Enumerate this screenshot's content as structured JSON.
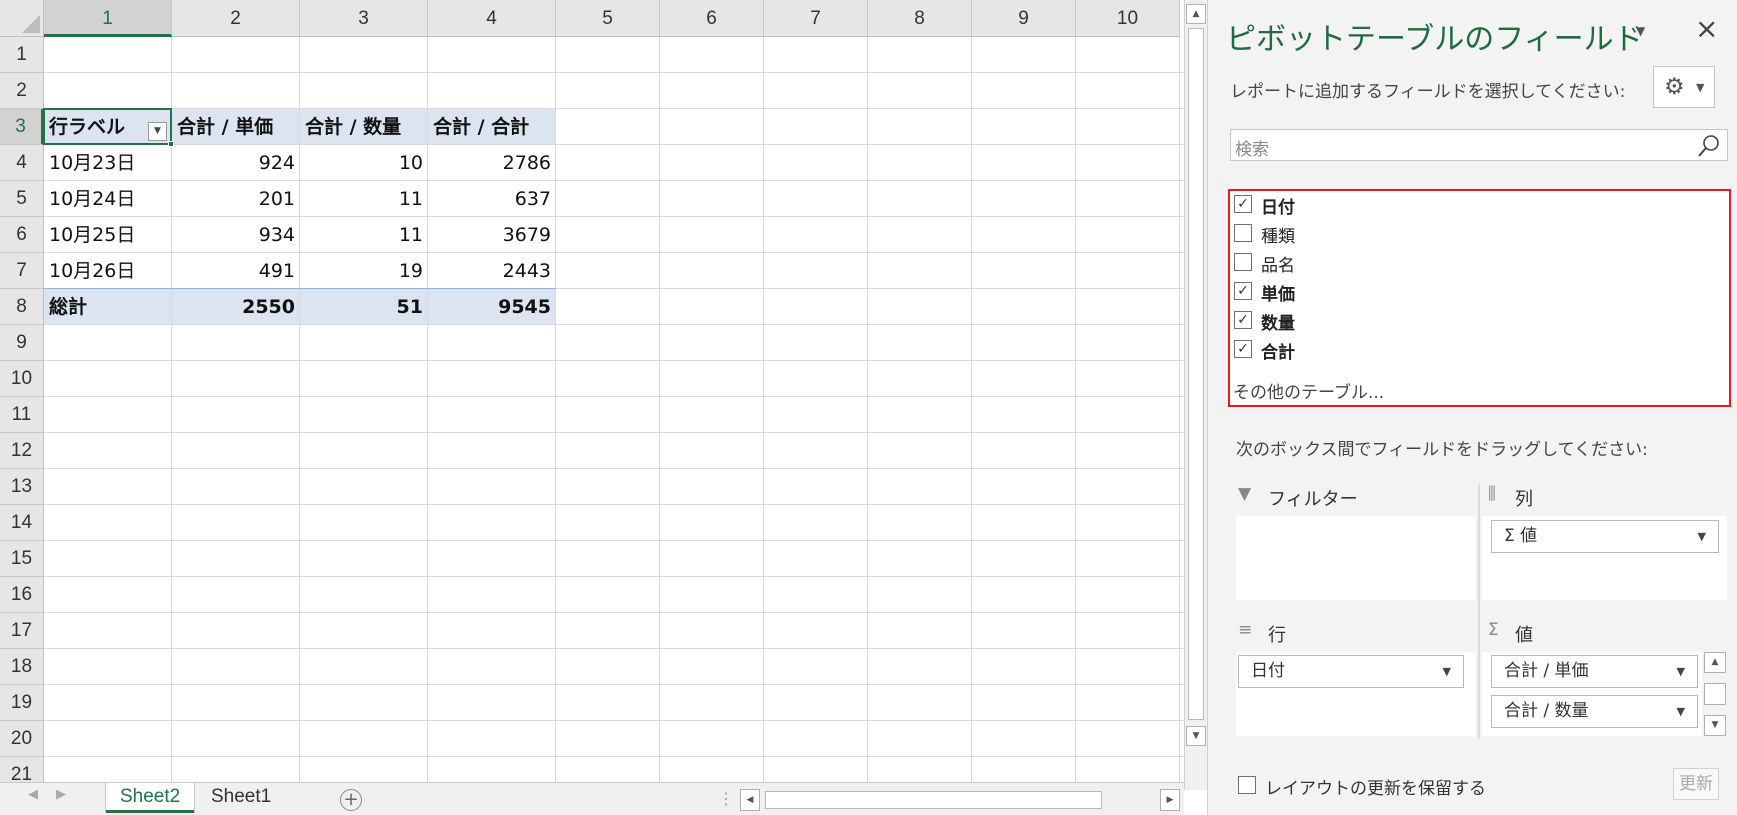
{
  "columns": [
    "1",
    "2",
    "3",
    "4",
    "5",
    "6",
    "7",
    "8",
    "9",
    "10"
  ],
  "rows": [
    "1",
    "2",
    "3",
    "4",
    "5",
    "6",
    "7",
    "8",
    "9",
    "10",
    "11",
    "12",
    "13",
    "14",
    "15",
    "16",
    "17",
    "18",
    "19",
    "20",
    "21"
  ],
  "pivot": {
    "headers": [
      "行ラベル",
      "合計 / 単価",
      "合計 / 数量",
      "合計 / 合計"
    ],
    "data": [
      [
        "10月23日",
        "924",
        "10",
        "2786"
      ],
      [
        "10月24日",
        "201",
        "11",
        "637"
      ],
      [
        "10月25日",
        "934",
        "11",
        "3679"
      ],
      [
        "10月26日",
        "491",
        "19",
        "2443"
      ]
    ],
    "total": [
      "総計",
      "2550",
      "51",
      "9545"
    ]
  },
  "sheet_tabs": [
    "Sheet2",
    "Sheet1"
  ],
  "active_tab": "Sheet2",
  "panel": {
    "title": "ピボットテーブルのフィールド",
    "subtitle": "レポートに追加するフィールドを選択してください:",
    "search_placeholder": "検索",
    "fields": [
      {
        "label": "日付",
        "checked": true
      },
      {
        "label": "種類",
        "checked": false
      },
      {
        "label": "品名",
        "checked": false
      },
      {
        "label": "単価",
        "checked": true
      },
      {
        "label": "数量",
        "checked": true
      },
      {
        "label": "合計",
        "checked": true
      }
    ],
    "more_tables": "その他のテーブル...",
    "drag_hint": "次のボックス間でフィールドをドラッグしてください:",
    "areas": {
      "filter": {
        "label": "フィルター",
        "items": []
      },
      "columns": {
        "label": "列",
        "items": [
          "Σ 値"
        ]
      },
      "rows": {
        "label": "行",
        "items": [
          "日付"
        ]
      },
      "values": {
        "label": "値",
        "items": [
          "合計 / 単価",
          "合計 / 数量"
        ]
      }
    },
    "defer_label": "レイアウトの更新を保留する",
    "update_label": "更新"
  },
  "colors": {
    "accent": "#217346",
    "highlight_border": "#e51c23",
    "pivot_header": "#dce4f2"
  }
}
